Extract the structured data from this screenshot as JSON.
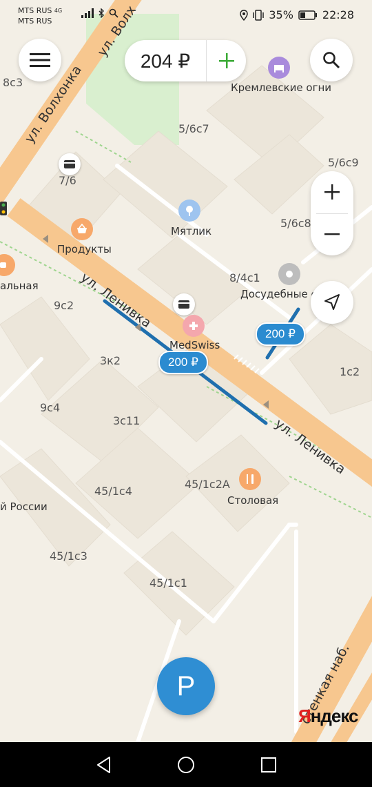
{
  "status_bar": {
    "carrier_1": "MTS RUS",
    "carrier_2": "MTS RUS",
    "network_badge": "4G",
    "battery_percent": "35%",
    "time": "22:28"
  },
  "header": {
    "balance": "204 ₽"
  },
  "map": {
    "streets": [
      {
        "id": "volkhonka",
        "text": "ул. Волхонка"
      },
      {
        "id": "volkh2",
        "text": "ул. Волх"
      },
      {
        "id": "lenivka1",
        "text": "ул. Ленивка"
      },
      {
        "id": "lenivka2",
        "text": "ул. Ленивка"
      },
      {
        "id": "nab",
        "text": "стенкая наб."
      }
    ],
    "places": [
      {
        "id": "kremlin_lights",
        "text": "Кремлевские огни"
      },
      {
        "id": "myatlik",
        "text": "Мятлик"
      },
      {
        "id": "produkty",
        "text": "Продукты"
      },
      {
        "id": "dosug",
        "text": "Досудебные с"
      },
      {
        "id": "medswiss",
        "text": "MedSwiss"
      },
      {
        "id": "stolovaya",
        "text": "Столовая"
      },
      {
        "id": "alnaya",
        "text": "альная"
      },
      {
        "id": "rossii",
        "text": "й России"
      }
    ],
    "buildings": [
      "8с3",
      "5/6с7",
      "5/6с9",
      "7/6",
      "5/6с8",
      "8/4с1",
      "9с2",
      "3к2",
      "1с2",
      "9с4",
      "3с11",
      "45/1с4",
      "45/1с2А",
      "45/1с3",
      "45/1с1"
    ]
  },
  "parking_prices": [
    "200 ₽",
    "200 ₽"
  ],
  "parking_button": "P",
  "logo": {
    "first": "Я",
    "rest": "ндекс"
  },
  "colors": {
    "accent": "#2b8bd0",
    "road_major": "#f7c78f",
    "map_bg": "#f3efe6",
    "parking_line": "#1f6fae",
    "plus_green": "#3aaa35"
  }
}
